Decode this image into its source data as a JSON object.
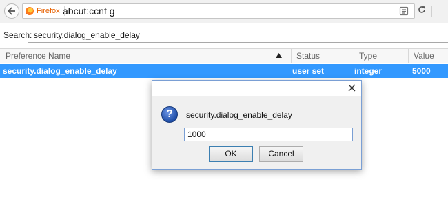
{
  "urlbar": {
    "identity_label": "Firefox",
    "url": "abcut:ccnf g"
  },
  "search": {
    "label": "Search:",
    "value": "security.dialog_enable_delay"
  },
  "table": {
    "columns": [
      "Preference Name",
      "Status",
      "Type",
      "Value"
    ],
    "selected_row": {
      "name": "security.dialog_enable_delay",
      "status": "user set",
      "type": "integer",
      "value": "5000"
    }
  },
  "dialog": {
    "message": "security.dialog_enable_delay",
    "input_value": "1000",
    "ok_label": "OK",
    "cancel_label": "Cancel"
  },
  "icons": {
    "back": "back-arrow-icon",
    "identity": "firefox-icon",
    "reader": "reader-view-icon",
    "reload": "reload-icon",
    "sort": "sort-ascending-icon",
    "close": "close-icon",
    "question": "question-icon"
  },
  "colors": {
    "selection": "#3399ff",
    "identity_text": "#e66000",
    "dialog_border": "#7a9fd4"
  }
}
